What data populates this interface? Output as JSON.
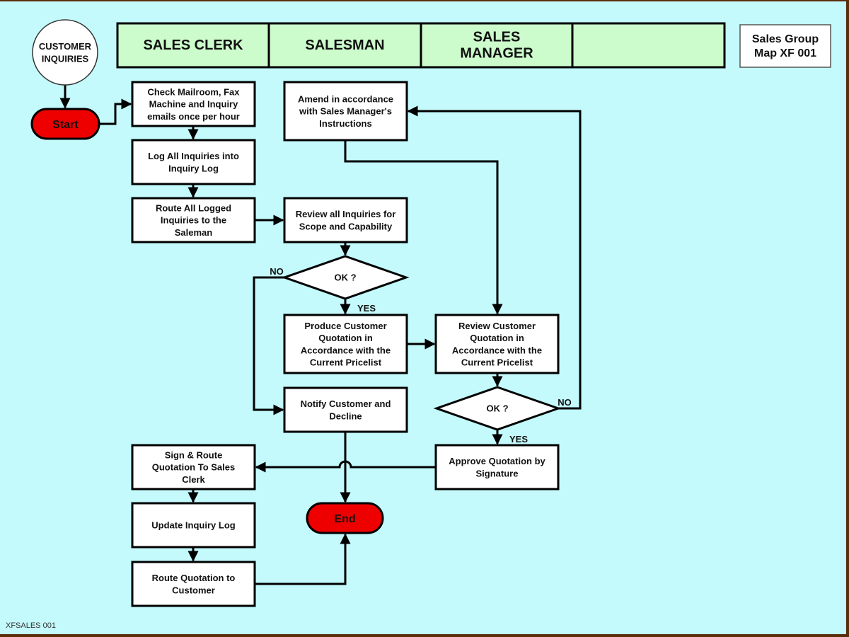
{
  "title_box": "Sales Group\nMap XF 001",
  "footer_code": "XFSALES 001",
  "colors": {
    "background": "#c4fafc",
    "border": "#5a2e0a",
    "lane_header": "#ccfbcc",
    "terminator": "#ee0000",
    "process": "#ffffff"
  },
  "lanes": [
    {
      "id": "sales-clerk",
      "label": "SALES CLERK"
    },
    {
      "id": "salesman",
      "label": "SALESMAN"
    },
    {
      "id": "sales-manager",
      "label": "SALES\nMANAGER"
    },
    {
      "id": "empty",
      "label": ""
    }
  ],
  "nodes": [
    {
      "id": "customer-inquiries",
      "type": "connector",
      "label": "CUSTOMER\nINQUIRIES"
    },
    {
      "id": "start",
      "type": "terminator",
      "label": "Start"
    },
    {
      "id": "check-mailroom",
      "type": "process",
      "label": "Check Mailroom, Fax\nMachine and Inquiry\nemails once per hour"
    },
    {
      "id": "log-inquiries",
      "type": "process",
      "label": "Log All Inquiries into\nInquiry Log"
    },
    {
      "id": "route-logged",
      "type": "process",
      "label": "Route All Logged\nInquiries to the\nSaleman"
    },
    {
      "id": "review-inquiries",
      "type": "process",
      "label": "Review all Inquiries for\nScope and Capability"
    },
    {
      "id": "ok-1",
      "type": "decision",
      "label": "OK ?"
    },
    {
      "id": "produce-quotation",
      "type": "process",
      "label": "Produce Customer\nQuotation in\nAccordance with the\nCurrent Pricelist"
    },
    {
      "id": "notify-decline",
      "type": "process",
      "label": "Notify Customer and\nDecline"
    },
    {
      "id": "amend",
      "type": "process",
      "label": "Amend in accordance\nwith Sales Manager's\nInstructions"
    },
    {
      "id": "review-quotation",
      "type": "process",
      "label": "Review Customer\nQuotation in\nAccordance with the\nCurrent Pricelist"
    },
    {
      "id": "ok-2",
      "type": "decision",
      "label": "OK ?"
    },
    {
      "id": "approve",
      "type": "process",
      "label": "Approve Quotation by\nSignature"
    },
    {
      "id": "sign-route",
      "type": "process",
      "label": "Sign & Route\nQuotation To Sales\nClerk"
    },
    {
      "id": "update-log",
      "type": "process",
      "label": "Update Inquiry Log"
    },
    {
      "id": "route-customer",
      "type": "process",
      "label": "Route Quotation to\nCustomer"
    },
    {
      "id": "end",
      "type": "terminator",
      "label": "End"
    }
  ],
  "edges": [
    {
      "from": "customer-inquiries",
      "to": "start",
      "label": ""
    },
    {
      "from": "start",
      "to": "check-mailroom",
      "label": ""
    },
    {
      "from": "check-mailroom",
      "to": "log-inquiries",
      "label": ""
    },
    {
      "from": "log-inquiries",
      "to": "route-logged",
      "label": ""
    },
    {
      "from": "route-logged",
      "to": "review-inquiries",
      "label": ""
    },
    {
      "from": "review-inquiries",
      "to": "ok-1",
      "label": ""
    },
    {
      "from": "ok-1",
      "to": "produce-quotation",
      "label": "YES"
    },
    {
      "from": "ok-1",
      "to": "notify-decline",
      "label": "NO"
    },
    {
      "from": "produce-quotation",
      "to": "review-quotation",
      "label": ""
    },
    {
      "from": "amend",
      "to": "review-quotation",
      "label": ""
    },
    {
      "from": "review-quotation",
      "to": "ok-2",
      "label": ""
    },
    {
      "from": "ok-2",
      "to": "approve",
      "label": "YES"
    },
    {
      "from": "ok-2",
      "to": "amend",
      "label": "NO"
    },
    {
      "from": "approve",
      "to": "sign-route",
      "label": ""
    },
    {
      "from": "notify-decline",
      "to": "end",
      "label": ""
    },
    {
      "from": "sign-route",
      "to": "update-log",
      "label": ""
    },
    {
      "from": "update-log",
      "to": "route-customer",
      "label": ""
    },
    {
      "from": "route-customer",
      "to": "end",
      "label": ""
    }
  ]
}
